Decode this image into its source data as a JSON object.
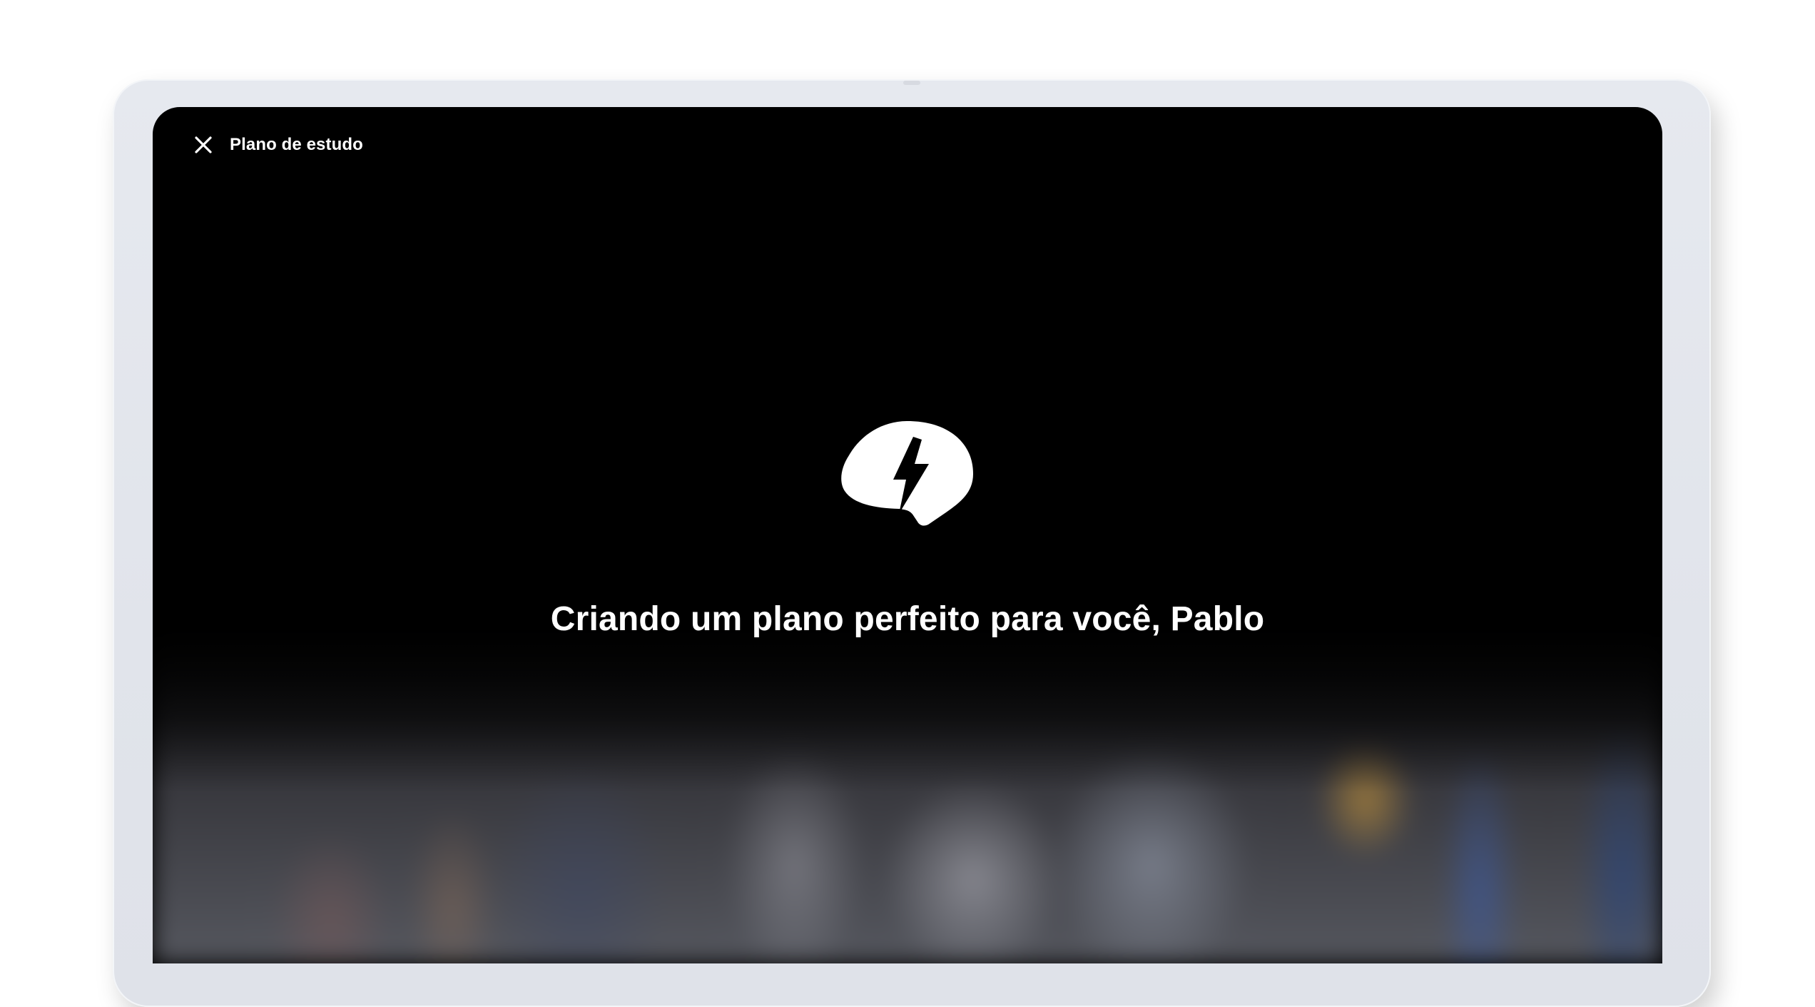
{
  "header": {
    "close_icon": "close-icon",
    "title": "Plano de estudo"
  },
  "main": {
    "logo_icon": "lightning-speech-bubble-icon",
    "headline": "Criando um plano perfeito para você, Pablo"
  },
  "colors": {
    "screen_background": "#000000",
    "text": "#ffffff",
    "device_frame": "#e3e6ec"
  }
}
